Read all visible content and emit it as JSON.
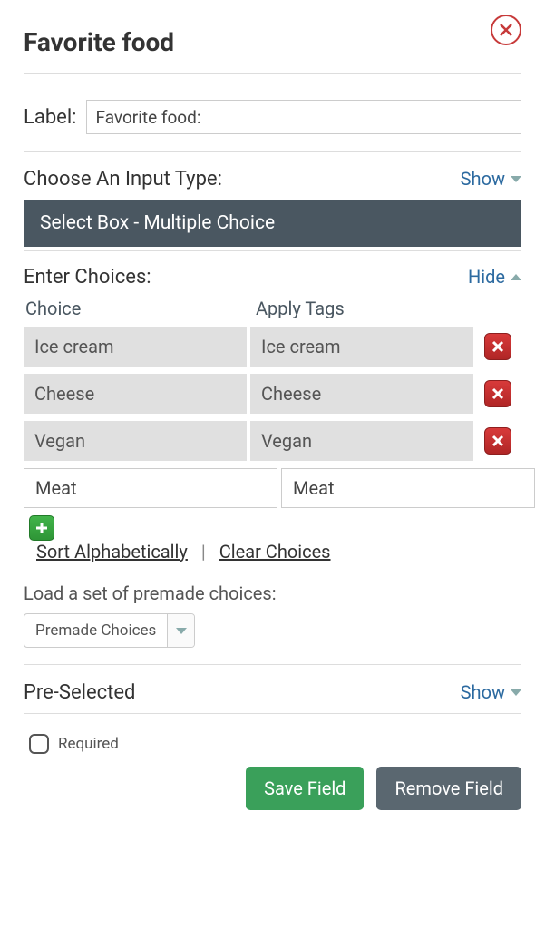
{
  "title": "Favorite food",
  "label": {
    "caption": "Label:",
    "value": "Favorite food:"
  },
  "inputType": {
    "heading": "Choose An Input Type:",
    "toggle": "Show",
    "selected": "Select Box - Multiple Choice"
  },
  "choices": {
    "heading": "Enter Choices:",
    "toggle": "Hide",
    "colChoice": "Choice",
    "colTags": "Apply Tags",
    "rows": [
      {
        "choice": "Ice cream",
        "tag": "Ice cream",
        "saved": true
      },
      {
        "choice": "Cheese",
        "tag": "Cheese",
        "saved": true
      },
      {
        "choice": "Vegan",
        "tag": "Vegan",
        "saved": true
      },
      {
        "choice": "Meat",
        "tag": "Meat",
        "saved": false
      }
    ],
    "sortLink": "Sort Alphabetically",
    "clearLink": "Clear Choices"
  },
  "premade": {
    "label": "Load a set of premade choices:",
    "selected": "Premade Choices"
  },
  "preSelected": {
    "heading": "Pre-Selected",
    "toggle": "Show"
  },
  "required": {
    "label": "Required",
    "checked": false
  },
  "buttons": {
    "save": "Save Field",
    "remove": "Remove Field"
  }
}
